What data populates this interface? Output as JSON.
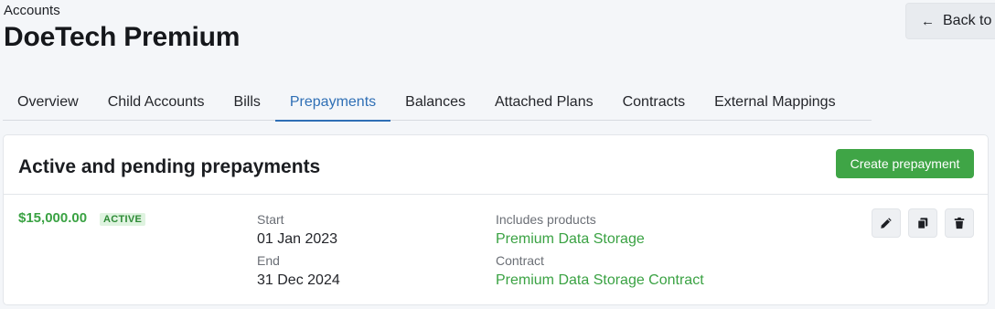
{
  "header": {
    "breadcrumb": "Accounts",
    "title": "DoeTech Premium",
    "back_label": "Back to"
  },
  "tabs": [
    {
      "label": "Overview",
      "active": false
    },
    {
      "label": "Child Accounts",
      "active": false
    },
    {
      "label": "Bills",
      "active": false
    },
    {
      "label": "Prepayments",
      "active": true
    },
    {
      "label": "Balances",
      "active": false
    },
    {
      "label": "Attached Plans",
      "active": false
    },
    {
      "label": "Contracts",
      "active": false
    },
    {
      "label": "External Mappings",
      "active": false
    }
  ],
  "section": {
    "title": "Active and pending prepayments",
    "create_label": "Create prepayment"
  },
  "prepayment": {
    "amount": "$15,000.00",
    "status": "ACTIVE",
    "start_label": "Start",
    "start_value": "01 Jan 2023",
    "end_label": "End",
    "end_value": "31 Dec 2024",
    "products_label": "Includes products",
    "products_value": "Premium Data Storage",
    "contract_label": "Contract",
    "contract_value": "Premium Data Storage Contract",
    "actions": [
      "pencil-icon",
      "copy-icon",
      "trash-icon"
    ]
  },
  "colors": {
    "accent_blue": "#2f6fb5",
    "success_green": "#3fa546",
    "link_green": "#3aa243"
  }
}
